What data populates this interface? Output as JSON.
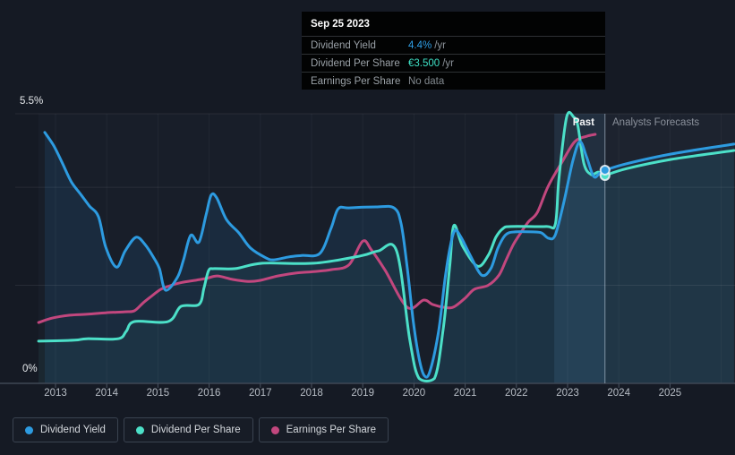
{
  "y_axis": {
    "top_label": "5.5%",
    "bottom_label": "0%"
  },
  "annotations": {
    "past": "Past",
    "forecast": "Analysts Forecasts"
  },
  "tooltip": {
    "date": "Sep 25 2023",
    "rows": [
      {
        "label": "Dividend Yield",
        "value": "4.4%",
        "suffix": "/yr",
        "color": "#2f9fe6"
      },
      {
        "label": "Dividend Per Share",
        "value": "€3.500",
        "suffix": "/yr",
        "color": "#3ee0c5"
      },
      {
        "label": "Earnings Per Share",
        "value": "No data",
        "suffix": "",
        "color": "#82898f"
      }
    ]
  },
  "legend": {
    "items": [
      {
        "label": "Dividend Yield",
        "color": "#2d9be0"
      },
      {
        "label": "Dividend Per Share",
        "color": "#4ce0c8"
      },
      {
        "label": "Earnings Per Share",
        "color": "#c2477e"
      }
    ]
  },
  "chart_data": {
    "type": "line",
    "x_axis": {
      "ticks": [
        2013,
        2014,
        2015,
        2016,
        2017,
        2018,
        2019,
        2020,
        2021,
        2022,
        2023,
        2024,
        2025
      ],
      "gridline_years": [
        2013,
        2014,
        2015,
        2016,
        2017,
        2018,
        2019,
        2020,
        2021,
        2022,
        2023,
        2024,
        2025,
        2026
      ]
    },
    "y_axis": {
      "min": 0,
      "max": 5.5,
      "unit": "%",
      "gridlines_pct": [
        2,
        4,
        5.5
      ]
    },
    "divider": {
      "year": 2023.73,
      "highlight_band_years": [
        2022.74,
        2023.73
      ],
      "past_label": "Past",
      "forecast_label": "Analysts Forecasts"
    },
    "markers": [
      {
        "series": "Dividend Per Share",
        "year": 2023.73,
        "pct": 4.24,
        "color": "#4ce0c8"
      },
      {
        "series": "Dividend Yield",
        "year": 2023.73,
        "pct": 4.35,
        "color": "#2d9be0"
      }
    ],
    "series": [
      {
        "name": "Earnings Per Share",
        "color": "#c2477e",
        "unit": "% of yield axis",
        "points": [
          [
            2012.67,
            1.24
          ],
          [
            2012.93,
            1.33
          ],
          [
            2013.28,
            1.39
          ],
          [
            2013.63,
            1.41
          ],
          [
            2013.98,
            1.44
          ],
          [
            2014.36,
            1.46
          ],
          [
            2014.54,
            1.48
          ],
          [
            2014.71,
            1.64
          ],
          [
            2014.89,
            1.79
          ],
          [
            2015.06,
            1.92
          ],
          [
            2015.29,
            2.01
          ],
          [
            2015.47,
            2.06
          ],
          [
            2015.71,
            2.1
          ],
          [
            2015.94,
            2.14
          ],
          [
            2016.16,
            2.19
          ],
          [
            2016.46,
            2.12
          ],
          [
            2016.76,
            2.08
          ],
          [
            2016.99,
            2.1
          ],
          [
            2017.34,
            2.19
          ],
          [
            2017.69,
            2.25
          ],
          [
            2018.04,
            2.28
          ],
          [
            2018.39,
            2.32
          ],
          [
            2018.73,
            2.42
          ],
          [
            2019.0,
            2.9
          ],
          [
            2019.17,
            2.72
          ],
          [
            2019.44,
            2.3
          ],
          [
            2019.87,
            1.55
          ],
          [
            2020.19,
            1.7
          ],
          [
            2020.36,
            1.61
          ],
          [
            2020.6,
            1.55
          ],
          [
            2020.78,
            1.56
          ],
          [
            2021.01,
            1.75
          ],
          [
            2021.18,
            1.92
          ],
          [
            2021.45,
            2.0
          ],
          [
            2021.66,
            2.21
          ],
          [
            2021.8,
            2.52
          ],
          [
            2021.94,
            2.83
          ],
          [
            2022.06,
            3.03
          ],
          [
            2022.23,
            3.29
          ],
          [
            2022.41,
            3.49
          ],
          [
            2022.62,
            4.02
          ],
          [
            2022.9,
            4.53
          ],
          [
            2023.14,
            4.93
          ],
          [
            2023.37,
            5.04
          ],
          [
            2023.54,
            5.08
          ]
        ],
        "forecast": []
      },
      {
        "name": "Dividend Per Share",
        "color": "#4ce0c8",
        "unit": "% of yield axis",
        "tooltip_value": "€3.500 /yr",
        "points": [
          [
            2012.67,
            0.86
          ],
          [
            2013.37,
            0.88
          ],
          [
            2013.61,
            0.91
          ],
          [
            2014.22,
            0.91
          ],
          [
            2014.38,
            1.06
          ],
          [
            2014.54,
            1.26
          ],
          [
            2015.2,
            1.26
          ],
          [
            2015.45,
            1.57
          ],
          [
            2015.8,
            1.61
          ],
          [
            2015.9,
            1.95
          ],
          [
            2015.99,
            2.3
          ],
          [
            2016.1,
            2.34
          ],
          [
            2016.51,
            2.34
          ],
          [
            2017.04,
            2.45
          ],
          [
            2018.04,
            2.45
          ],
          [
            2018.96,
            2.6
          ],
          [
            2019.3,
            2.7
          ],
          [
            2019.66,
            2.7
          ],
          [
            2019.92,
            0.88
          ],
          [
            2020.1,
            0.1
          ],
          [
            2020.4,
            0.1
          ],
          [
            2020.57,
            1.1
          ],
          [
            2020.7,
            2.4
          ],
          [
            2020.78,
            3.22
          ],
          [
            2020.95,
            2.8
          ],
          [
            2021.24,
            2.39
          ],
          [
            2021.45,
            2.61
          ],
          [
            2021.6,
            2.98
          ],
          [
            2021.74,
            3.16
          ],
          [
            2021.9,
            3.2
          ],
          [
            2022.58,
            3.2
          ],
          [
            2022.76,
            3.25
          ],
          [
            2022.83,
            4.17
          ],
          [
            2022.98,
            5.43
          ],
          [
            2023.12,
            5.43
          ],
          [
            2023.2,
            5.26
          ],
          [
            2023.32,
            4.48
          ],
          [
            2023.46,
            4.26
          ],
          [
            2023.6,
            4.31
          ],
          [
            2023.73,
            4.24
          ]
        ],
        "forecast": [
          [
            2023.73,
            4.24
          ],
          [
            2024.15,
            4.38
          ],
          [
            2025.03,
            4.57
          ],
          [
            2026.25,
            4.75
          ]
        ]
      },
      {
        "name": "Dividend Yield",
        "color": "#2d9be0",
        "unit": "%",
        "tooltip_value": "4.4% /yr",
        "points": [
          [
            2012.79,
            5.12
          ],
          [
            2012.97,
            4.84
          ],
          [
            2013.14,
            4.48
          ],
          [
            2013.31,
            4.11
          ],
          [
            2013.49,
            3.86
          ],
          [
            2013.66,
            3.62
          ],
          [
            2013.84,
            3.4
          ],
          [
            2013.98,
            2.78
          ],
          [
            2014.19,
            2.37
          ],
          [
            2014.36,
            2.7
          ],
          [
            2014.57,
            2.98
          ],
          [
            2014.75,
            2.83
          ],
          [
            2014.92,
            2.56
          ],
          [
            2015.03,
            2.34
          ],
          [
            2015.15,
            1.9
          ],
          [
            2015.38,
            2.16
          ],
          [
            2015.5,
            2.52
          ],
          [
            2015.64,
            3.02
          ],
          [
            2015.8,
            2.88
          ],
          [
            2015.94,
            3.44
          ],
          [
            2016.04,
            3.84
          ],
          [
            2016.15,
            3.78
          ],
          [
            2016.34,
            3.34
          ],
          [
            2016.58,
            3.07
          ],
          [
            2016.81,
            2.76
          ],
          [
            2017.11,
            2.56
          ],
          [
            2017.26,
            2.52
          ],
          [
            2017.56,
            2.58
          ],
          [
            2017.81,
            2.61
          ],
          [
            2018.16,
            2.65
          ],
          [
            2018.38,
            3.16
          ],
          [
            2018.52,
            3.56
          ],
          [
            2018.73,
            3.58
          ],
          [
            2019.26,
            3.6
          ],
          [
            2019.61,
            3.58
          ],
          [
            2019.75,
            3.25
          ],
          [
            2019.87,
            2.34
          ],
          [
            2019.99,
            1.24
          ],
          [
            2020.1,
            0.51
          ],
          [
            2020.2,
            0.16
          ],
          [
            2020.31,
            0.24
          ],
          [
            2020.48,
            1.06
          ],
          [
            2020.61,
            2.16
          ],
          [
            2020.71,
            2.8
          ],
          [
            2020.8,
            3.12
          ],
          [
            2020.92,
            2.98
          ],
          [
            2021.1,
            2.61
          ],
          [
            2021.32,
            2.21
          ],
          [
            2021.5,
            2.34
          ],
          [
            2021.64,
            2.76
          ],
          [
            2021.79,
            3.03
          ],
          [
            2021.97,
            3.09
          ],
          [
            2022.32,
            3.09
          ],
          [
            2022.49,
            3.07
          ],
          [
            2022.63,
            2.96
          ],
          [
            2022.76,
            3.03
          ],
          [
            2022.93,
            3.71
          ],
          [
            2023.1,
            4.53
          ],
          [
            2023.24,
            4.93
          ],
          [
            2023.37,
            4.62
          ],
          [
            2023.51,
            4.22
          ],
          [
            2023.63,
            4.29
          ],
          [
            2023.73,
            4.35
          ]
        ],
        "forecast": [
          [
            2023.73,
            4.35
          ],
          [
            2024.15,
            4.48
          ],
          [
            2025.03,
            4.68
          ],
          [
            2026.25,
            4.88
          ]
        ]
      }
    ]
  }
}
